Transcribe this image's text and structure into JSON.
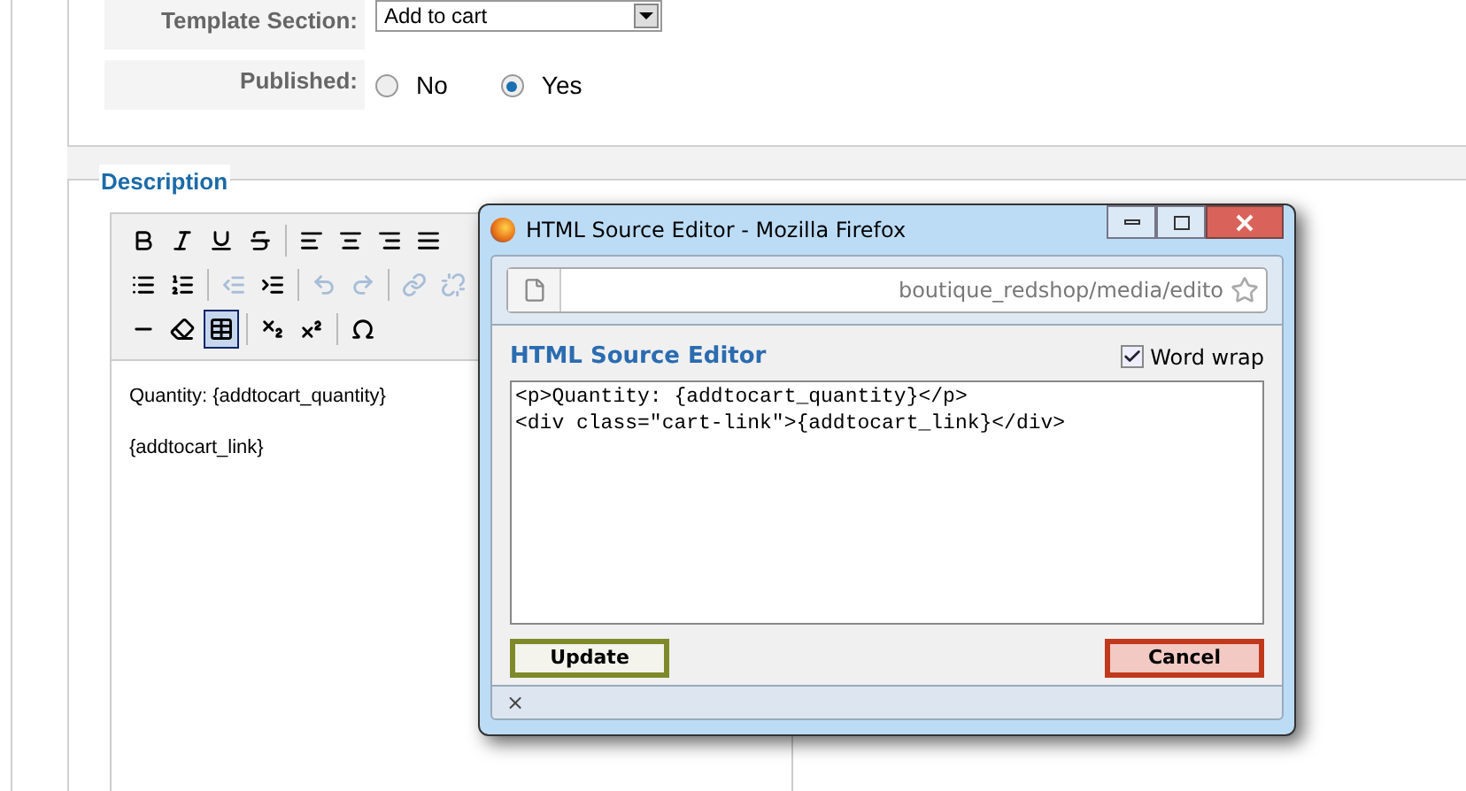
{
  "form": {
    "rows": [
      {
        "kind": "select",
        "label": "Template Section:",
        "value": "Add to cart"
      },
      {
        "kind": "radio",
        "label": "Published:",
        "options": [
          {
            "label": "No",
            "selected": false
          },
          {
            "label": "Yes",
            "selected": true
          }
        ]
      }
    ]
  },
  "description": {
    "legend": "Description",
    "toolbar": [
      [
        {
          "selected": false,
          "disabled": false
        },
        {
          "selected": false,
          "disabled": false
        },
        {
          "selected": false,
          "disabled": false
        },
        {
          "selected": false,
          "disabled": false
        },
        {
          "selected": false,
          "disabled": false
        },
        {
          "selected": false,
          "disabled": false
        },
        {
          "selected": false,
          "disabled": false
        },
        {
          "selected": false,
          "disabled": false
        }
      ],
      [
        {
          "selected": false,
          "disabled": false
        },
        {
          "selected": false,
          "disabled": false
        },
        {
          "selected": false,
          "disabled": true
        },
        {
          "selected": false,
          "disabled": false
        },
        {
          "selected": false,
          "disabled": true
        },
        {
          "selected": false,
          "disabled": true
        },
        {
          "selected": false,
          "disabled": true
        },
        {
          "selected": false,
          "disabled": true
        }
      ],
      [
        {
          "selected": false,
          "disabled": false
        },
        {
          "selected": false,
          "disabled": false
        },
        {
          "selected": true,
          "disabled": false
        },
        {
          "selected": false,
          "disabled": false
        },
        {
          "selected": false,
          "disabled": false
        },
        {
          "selected": false,
          "disabled": false
        }
      ]
    ],
    "content": [
      "Quantity: {addtocart_quantity}",
      "{addtocart_link}"
    ]
  },
  "popup": {
    "title": "HTML Source Editor - Mozilla Firefox",
    "url": "boutique_redshop/media/edito",
    "heading": "HTML Source Editor",
    "word_wrap": {
      "label": "Word wrap",
      "checked": true
    },
    "source_lines": [
      "<p>Quantity: {addtocart_quantity}</p>",
      "<div class=\"cart-link\">{addtocart_link}</div>"
    ],
    "buttons": [
      {
        "kind": "confirm",
        "label": "Update"
      },
      {
        "kind": "cancel",
        "label": "Cancel"
      }
    ],
    "status": "×"
  }
}
